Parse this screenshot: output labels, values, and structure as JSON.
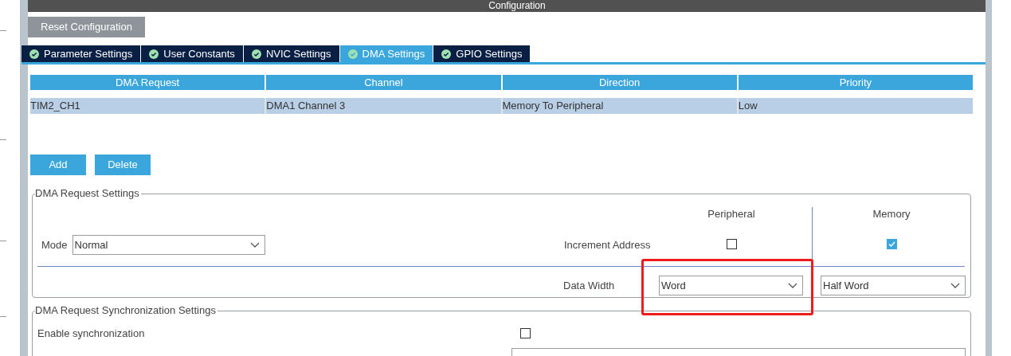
{
  "panel_title": "Configuration",
  "reset_button": "Reset Configuration",
  "tabs": [
    {
      "label": "Parameter Settings",
      "selected": false
    },
    {
      "label": "User Constants",
      "selected": false
    },
    {
      "label": "NVIC Settings",
      "selected": false
    },
    {
      "label": "DMA Settings",
      "selected": true
    },
    {
      "label": "GPIO Settings",
      "selected": false
    }
  ],
  "table": {
    "columns": [
      "DMA Request",
      "Channel",
      "Direction",
      "Priority"
    ],
    "rows": [
      {
        "cells": [
          "TIM2_CH1",
          "DMA1 Channel 3",
          "Memory To Peripheral",
          "Low"
        ],
        "selected": true
      }
    ]
  },
  "buttons": [
    "Add",
    "Delete"
  ],
  "request_settings": {
    "title": "DMA Request Settings",
    "mode_label": "Mode",
    "mode_value": "Normal",
    "peripheral_header": "Peripheral",
    "memory_header": "Memory",
    "increment_label": "Increment Address",
    "peripheral_increment": false,
    "memory_increment": true,
    "data_width_label": "Data Width",
    "peripheral_width": "Word",
    "memory_width": "Half Word"
  },
  "sync_settings": {
    "title": "DMA Request Synchronization Settings",
    "enable_label": "Enable synchronization",
    "enabled": false
  }
}
